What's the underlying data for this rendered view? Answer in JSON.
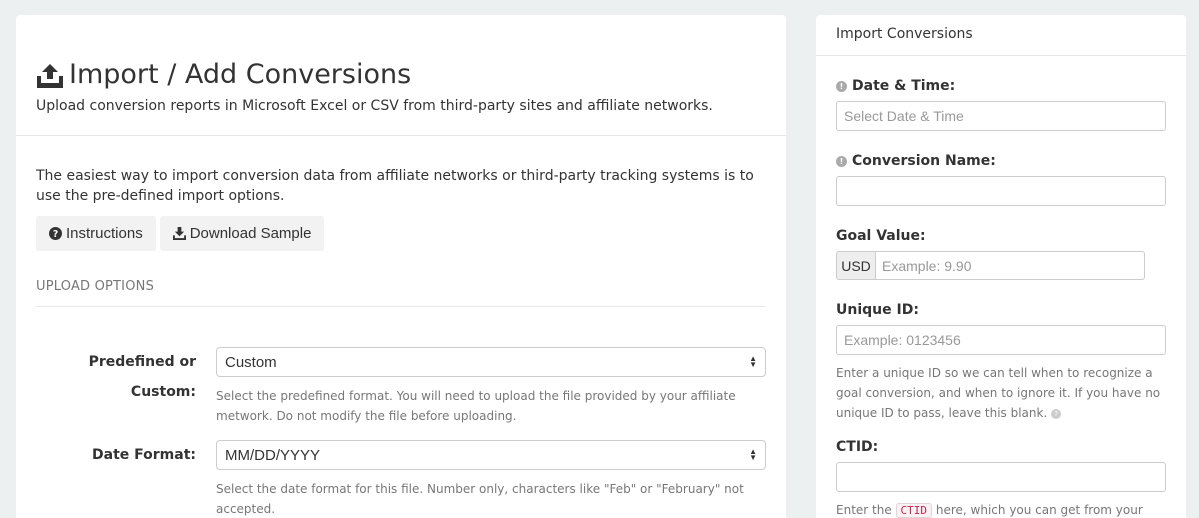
{
  "main": {
    "title": "Import / Add Conversions",
    "subtitle": "Upload conversion reports in Microsoft Excel or CSV from third-party sites and affiliate networks.",
    "intro": "The easiest way to import conversion data from affiliate networks or third-party tracking systems is to use the pre-defined import options.",
    "buttons": {
      "instructions": "Instructions",
      "download_sample": "Download Sample"
    },
    "section_title": "UPLOAD OPTIONS",
    "predefined": {
      "label": "Predefined or Custom:",
      "value": "Custom",
      "help": "Select the predefined format. You will need to upload the file provided by your affiliate metwork. Do not modify the file before uploading."
    },
    "date_format": {
      "label": "Date Format:",
      "value": "MM/DD/YYYY",
      "help": "Select the date format for this file. Number only, characters like \"Feb\" or \"February\" not accepted."
    }
  },
  "side": {
    "title": "Import Conversions",
    "date_time": {
      "label": "Date & Time:",
      "placeholder": "Select Date & Time"
    },
    "conversion_name": {
      "label": "Conversion Name:",
      "placeholder": ""
    },
    "goal_value": {
      "label": "Goal Value:",
      "currency": "USD",
      "placeholder": "Example: 9.90"
    },
    "unique_id": {
      "label": "Unique ID:",
      "placeholder": "Example: 0123456",
      "help": "Enter a unique ID so we can tell when to recognize a goal conversion, and when to ignore it. If you have no unique ID to pass, leave this blank."
    },
    "ctid": {
      "label": "CTID:",
      "placeholder": "",
      "help_prefix": "Enter the",
      "code": "CTID",
      "help_suffix": "here, which you can get from your"
    }
  },
  "colors": {
    "background": "#ecf0f1",
    "panel": "#ffffff",
    "code_text": "#c7254e"
  }
}
